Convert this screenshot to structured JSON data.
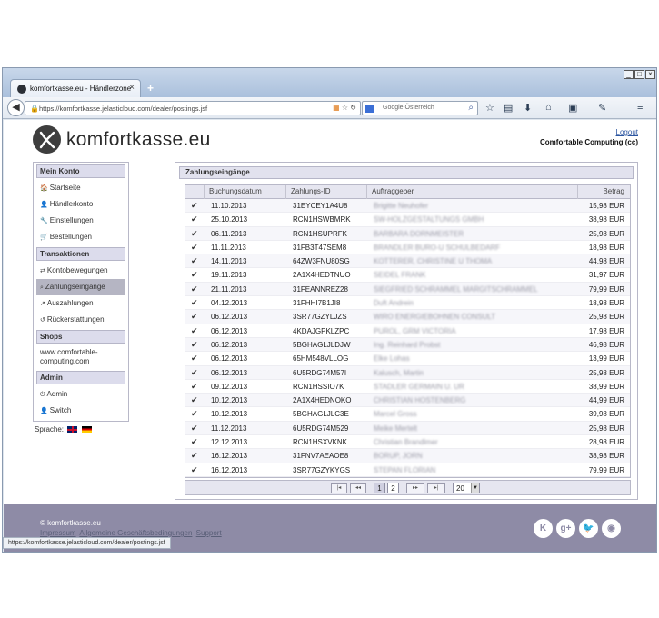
{
  "browser": {
    "tab_title": "komfortkasse.eu - Händlerzone",
    "tab_close": "×",
    "new_tab": "+",
    "url": "https://komfortkasse.jelasticloud.com/dealer/postings.jsf",
    "search_placeholder": "Google Österreich",
    "window_controls": [
      "_",
      "□",
      "×"
    ]
  },
  "header": {
    "logo": "komfortkasse.eu",
    "logout": "Logout",
    "company": "Comfortable Computing (cc)"
  },
  "sidebar": {
    "sections": [
      {
        "title": "Mein Konto",
        "items": [
          {
            "icon": "home-icon",
            "glyph": "🏠",
            "label": "Startseite"
          },
          {
            "icon": "user-icon",
            "glyph": "👤",
            "label": "Händlerkonto"
          },
          {
            "icon": "wrench-icon",
            "glyph": "🔧",
            "label": "Einstellungen"
          },
          {
            "icon": "cart-icon",
            "glyph": "🛒",
            "label": "Bestellungen"
          }
        ]
      },
      {
        "title": "Transaktionen",
        "items": [
          {
            "icon": "transfer-icon",
            "glyph": "⇄",
            "label": "Kontobewegungen"
          },
          {
            "icon": "search-icon",
            "glyph": "⌕",
            "label": "Zahlungseingänge",
            "active": true
          },
          {
            "icon": "payout-icon",
            "glyph": "↗",
            "label": "Auszahlungen"
          },
          {
            "icon": "refund-icon",
            "glyph": "↺",
            "label": "Rückerstattungen"
          }
        ]
      },
      {
        "title": "Shops",
        "shop_url": "www.comfortable-computing.com"
      },
      {
        "title": "Admin",
        "items": [
          {
            "icon": "power-icon",
            "glyph": "⏻",
            "label": "Admin"
          },
          {
            "icon": "switch-user-icon",
            "glyph": "👤",
            "label": "Switch"
          }
        ]
      }
    ],
    "language_label": "Sprache:"
  },
  "panel": {
    "title": "Zahlungseingänge",
    "columns": [
      "Buchungsdatum",
      "Zahlungs-ID",
      "Auftraggeber",
      "Betrag"
    ],
    "rows": [
      {
        "date": "11.10.2013",
        "id": "31EYCEY1A4U8",
        "payer": "Brigitte Neuhofer",
        "amount": "15,98 EUR"
      },
      {
        "date": "25.10.2013",
        "id": "RCN1HSWBMRK",
        "payer": "SW-HOLZGESTALTUNGS GMBH",
        "amount": "38,98 EUR"
      },
      {
        "date": "06.11.2013",
        "id": "RCN1HSUPRFK",
        "payer": "BARBARA DORNMEISTER",
        "amount": "25,98 EUR"
      },
      {
        "date": "11.11.2013",
        "id": "31FB3T47SEM8",
        "payer": "BRANDLER BURO-U SCHULBEDARF",
        "amount": "18,98 EUR"
      },
      {
        "date": "14.11.2013",
        "id": "64ZW3FNU80SG",
        "payer": "KOTTERER, CHRISTINE U THOMA",
        "amount": "44,98 EUR"
      },
      {
        "date": "19.11.2013",
        "id": "2A1X4HEDTNUO",
        "payer": "SEIDEL FRANK",
        "amount": "31,97 EUR"
      },
      {
        "date": "21.11.2013",
        "id": "31FEANNREZ28",
        "payer": "SIEGFRIED SCHRAMMEL MARGITSCHRAMMEL",
        "amount": "79,99 EUR"
      },
      {
        "date": "04.12.2013",
        "id": "31FHHI7B1JI8",
        "payer": "Duft Andrein",
        "amount": "18,98 EUR"
      },
      {
        "date": "06.12.2013",
        "id": "3SR77GZYLJZS",
        "payer": "WIRO ENERGIEBOHNEN CONSULT",
        "amount": "25,98 EUR"
      },
      {
        "date": "06.12.2013",
        "id": "4KDAJGPKLZPC",
        "payer": "PUROL, GRM VICTORIA",
        "amount": "17,98 EUR"
      },
      {
        "date": "06.12.2013",
        "id": "5BGHAGLJLDJW",
        "payer": "Ing. Reinhard Probst",
        "amount": "46,98 EUR"
      },
      {
        "date": "06.12.2013",
        "id": "65HM548VLLOG",
        "payer": "Elke Lohas",
        "amount": "13,99 EUR"
      },
      {
        "date": "06.12.2013",
        "id": "6U5RDG74M57I",
        "payer": "Kalusch, Martin",
        "amount": "25,98 EUR"
      },
      {
        "date": "09.12.2013",
        "id": "RCN1HSSIO7K",
        "payer": "STADLER GERMAIN U. UR",
        "amount": "38,99 EUR"
      },
      {
        "date": "10.12.2013",
        "id": "2A1X4HEDNOKO",
        "payer": "CHRISTIAN HOSTENBERG",
        "amount": "44,99 EUR"
      },
      {
        "date": "10.12.2013",
        "id": "5BGHAGLJLC3E",
        "payer": "Marcel Gross",
        "amount": "39,98 EUR"
      },
      {
        "date": "11.12.2013",
        "id": "6U5RDG74M529",
        "payer": "Meike Mertelt",
        "amount": "25,98 EUR"
      },
      {
        "date": "12.12.2013",
        "id": "RCN1HSXVKNK",
        "payer": "Christian Brandlmer",
        "amount": "28,98 EUR"
      },
      {
        "date": "16.12.2013",
        "id": "31FNV7AEAOE8",
        "payer": "BORUP, JORN",
        "amount": "38,98 EUR"
      },
      {
        "date": "16.12.2013",
        "id": "3SR77GZYKYGS",
        "payer": "STEPAN FLORIAN",
        "amount": "79,99 EUR"
      }
    ],
    "pager": {
      "first": "|◂",
      "prev": "◂◂",
      "pages": [
        "1",
        "2"
      ],
      "next": "▸▸",
      "last": "▸|",
      "page_size": "20"
    }
  },
  "footer": {
    "copyright": "© komfortkasse.eu",
    "links": [
      "Impressum",
      "Allgemeine Geschäftsbedingungen",
      "Support"
    ]
  },
  "status_url": "https://komfortkasse.jelasticloud.com/dealer/postings.jsf",
  "colors": {
    "footer": "#8e8ba6",
    "accent_link": "#2b55a0",
    "sidebar_active": "#b5b5c3"
  }
}
